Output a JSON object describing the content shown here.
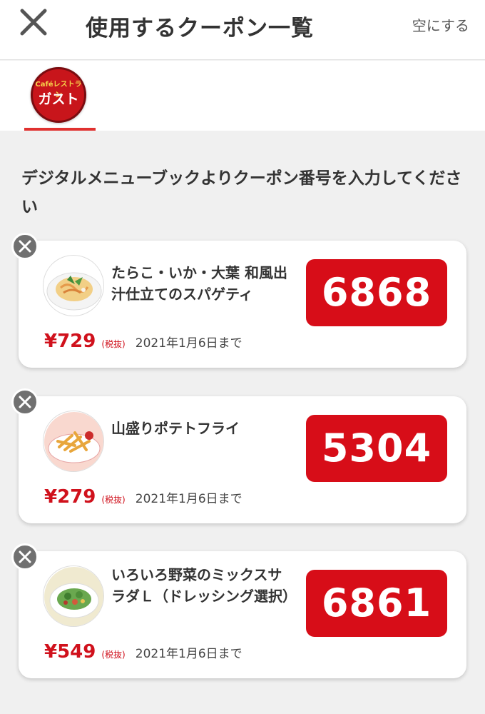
{
  "header": {
    "title": "使用するクーポン一覧",
    "clear_label": "空にする",
    "close_icon": "close-icon"
  },
  "brand_tab": {
    "logo_top_text": "Caféレストラン",
    "logo_main_text": "ガスト",
    "accent_color": "#e0312f"
  },
  "instruction": "デジタルメニューブックよりクーポン番号を入力してください",
  "coupons": [
    {
      "name": "たらこ・いか・大葉 和風出汁仕立てのスパゲティ",
      "price": "¥729",
      "tax": "(税抜)",
      "until": "2021年1月6日まで",
      "code": "6868"
    },
    {
      "name": "山盛りポテトフライ",
      "price": "¥279",
      "tax": "(税抜)",
      "until": "2021年1月6日まで",
      "code": "5304"
    },
    {
      "name": "いろいろ野菜のミックスサラダＬ（ドレッシング選択）",
      "price": "¥549",
      "tax": "(税抜)",
      "until": "2021年1月6日まで",
      "code": "6861"
    }
  ],
  "colors": {
    "code_bg": "#d70d18",
    "price": "#d0111c",
    "page_bg": "#f0f0f0"
  }
}
